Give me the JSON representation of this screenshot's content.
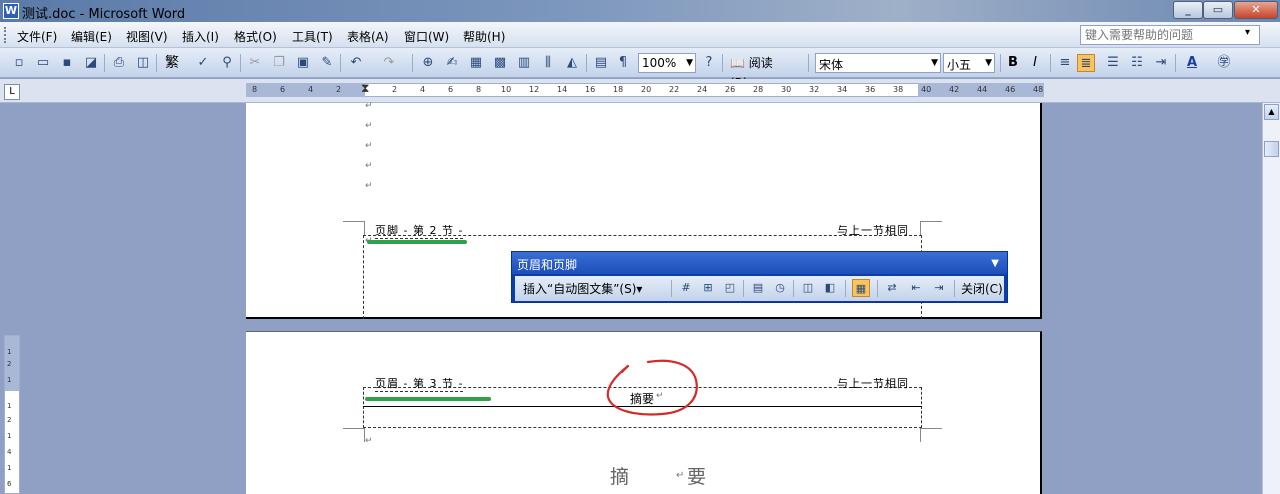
{
  "window": {
    "title": "测试.doc - Microsoft Word",
    "icon_letter": "W",
    "min": "_",
    "max": "▭",
    "close": "✕"
  },
  "menubar": {
    "items": [
      "文件(F)",
      "编辑(E)",
      "视图(V)",
      "插入(I)",
      "格式(O)",
      "工具(T)",
      "表格(A)",
      "窗口(W)",
      "帮助(H)"
    ],
    "help_placeholder": "键入需要帮助的问题",
    "help_dropdown": "▾"
  },
  "toolbar": {
    "zoom": "100%",
    "read_label": "阅读(R)",
    "font": "宋体",
    "font_size": "小五",
    "traditional": "繁",
    "bold": "B",
    "italic": "I",
    "font_color": "A"
  },
  "ruler": {
    "ticks": [
      "8",
      "6",
      "4",
      "2",
      "",
      "2",
      "4",
      "6",
      "8",
      "10",
      "12",
      "14",
      "16",
      "18",
      "20",
      "22",
      "24",
      "26",
      "28",
      "30",
      "32",
      "34",
      "36",
      "38",
      "40",
      "42",
      "44",
      "46",
      "48"
    ],
    "tab_selector": "L",
    "vticks": [
      "1",
      "2",
      "1",
      "",
      "1",
      "2",
      "1",
      "4",
      "1",
      "6"
    ]
  },
  "page1": {
    "paragraph_mark": "↵",
    "footer_label": "页脚 - 第 2 节 -",
    "same_as_previous": "与上一节相同"
  },
  "hf_toolbar": {
    "title": "页眉和页脚",
    "collapse": "▼",
    "insert_autotext": "插入“自动图文集”(S)▾",
    "close": "关闭(C)",
    "icons": [
      "#",
      "⊞",
      "◰",
      "▤",
      "◷",
      "◫",
      "◧",
      "▦",
      "⇄",
      "⇤",
      "⇥"
    ]
  },
  "page2": {
    "header_label": "页眉 - 第 3 节 -",
    "same_as_previous": "与上一节相同",
    "header_text": "摘要",
    "paragraph_mark": "↵",
    "heading": "摘 要"
  },
  "colors": {
    "title_bar": "#5b7aa8",
    "highlight_green": "#2fa14a",
    "annotation_red": "#d42a2a",
    "hf_toolbar_blue": "#1c4fb8"
  }
}
